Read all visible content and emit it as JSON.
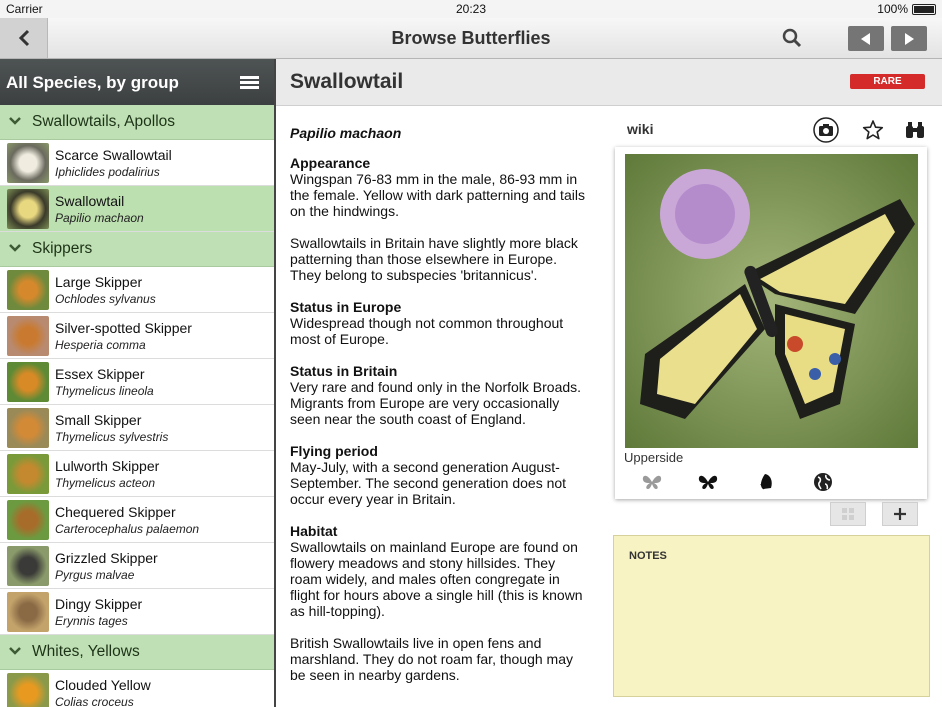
{
  "status_bar": {
    "carrier": "Carrier",
    "time": "20:23",
    "battery": "100%"
  },
  "nav": {
    "title": "Browse Butterflies"
  },
  "sidebar": {
    "header": "All Species, by group",
    "groups": [
      {
        "label": "Swallowtails, Apollos"
      },
      {
        "label": "Skippers"
      },
      {
        "label": "Whites, Yellows"
      }
    ],
    "species": [
      {
        "name": "Scarce Swallowtail",
        "sci": "Iphiclides podalirius"
      },
      {
        "name": "Swallowtail",
        "sci": "Papilio machaon"
      },
      {
        "name": "Large Skipper",
        "sci": "Ochlodes sylvanus"
      },
      {
        "name": "Silver-spotted Skipper",
        "sci": "Hesperia comma"
      },
      {
        "name": "Essex Skipper",
        "sci": "Thymelicus lineola"
      },
      {
        "name": "Small Skipper",
        "sci": "Thymelicus sylvestris"
      },
      {
        "name": "Lulworth Skipper",
        "sci": "Thymelicus acteon"
      },
      {
        "name": "Chequered Skipper",
        "sci": "Carterocephalus palaemon"
      },
      {
        "name": "Grizzled Skipper",
        "sci": "Pyrgus malvae"
      },
      {
        "name": "Dingy Skipper",
        "sci": "Erynnis tages"
      },
      {
        "name": "Clouded Yellow",
        "sci": "Colias croceus"
      }
    ]
  },
  "detail": {
    "title": "Swallowtail",
    "badge": "RARE",
    "scientific_name": "Papilio machaon",
    "sections": [
      {
        "heading": "Appearance",
        "body": "Wingspan 76-83 mm in the male, 86-93 mm in the female. Yellow with dark patterning and tails on the hindwings."
      },
      {
        "heading": "",
        "body": "Swallowtails in Britain have slightly more black patterning than those elsewhere in Europe. They belong to subspecies 'britannicus'."
      },
      {
        "heading": "Status in Europe",
        "body": "Widespread though not common throughout most of Europe."
      },
      {
        "heading": "Status in Britain",
        "body": "Very rare and found only in the Norfolk Broads. Migrants from Europe are very occasionally seen near the south coast of England."
      },
      {
        "heading": "Flying period",
        "body": "May-July, with a second generation August-September. The second generation does not occur every year in Britain."
      },
      {
        "heading": "Habitat",
        "body": "Swallowtails on mainland Europe are found on flowery meadows and stony hillsides. They roam widely, and males often congregate in flight for hours above a single hill (this is known as hill-topping)."
      },
      {
        "heading": "",
        "body": "British Swallowtails live in open fens and marshland. They do not roam far, though may be seen in nearby gardens."
      }
    ],
    "wiki_label": "wiki",
    "image_caption": "Upperside",
    "notes_label": "NOTES"
  },
  "colors": {
    "selected_row": "#bde0b0",
    "group_header": "#bfe0b5",
    "rare_badge": "#d42a2a",
    "notes_bg": "#f7f3c3"
  },
  "icons": [
    "back-icon",
    "search-icon",
    "prev-arrow-icon",
    "next-arrow-icon",
    "menu-icon",
    "chevron-down-icon",
    "camera-icon",
    "star-icon",
    "binoculars-icon",
    "butterfly-upperside-icon",
    "butterfly-icon",
    "butterfly-side-icon",
    "globe-icon",
    "grid-icon",
    "plus-icon"
  ]
}
